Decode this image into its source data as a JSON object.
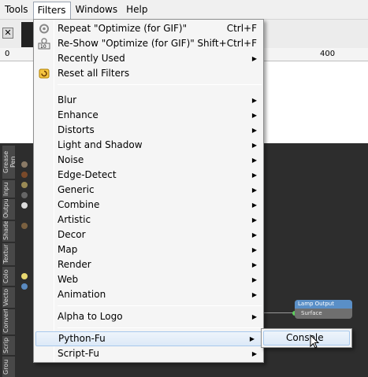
{
  "menubar": {
    "items": [
      {
        "label": "Tools"
      },
      {
        "label": "Filters"
      },
      {
        "label": "Windows"
      },
      {
        "label": "Help"
      }
    ]
  },
  "ruler": {
    "labels": [
      "0",
      "400"
    ]
  },
  "side_tabs": [
    "Grease Pen",
    "Inpu",
    "Outpu",
    "Shade",
    "Textur",
    "Colo",
    "Vecto",
    "Convert",
    "Scrip",
    "Grou"
  ],
  "node": {
    "title": "Lamp Output",
    "socket": "Surface"
  },
  "filters_menu": {
    "repeat": {
      "label": "Repeat \"Optimize (for GIF)\"",
      "shortcut": "Ctrl+F",
      "icon": "repeat-icon"
    },
    "reshow": {
      "label": "Re-Show \"Optimize (for GIF)\"",
      "shortcut": "Shift+Ctrl+F",
      "icon": "reshow-icon"
    },
    "recently_used": {
      "label": "Recently Used"
    },
    "reset_all": {
      "label": "Reset all Filters",
      "icon": "reset-icon"
    },
    "categories": [
      {
        "label": "Blur"
      },
      {
        "label": "Enhance"
      },
      {
        "label": "Distorts"
      },
      {
        "label": "Light and Shadow"
      },
      {
        "label": "Noise"
      },
      {
        "label": "Edge-Detect"
      },
      {
        "label": "Generic"
      },
      {
        "label": "Combine"
      },
      {
        "label": "Artistic"
      },
      {
        "label": "Decor"
      },
      {
        "label": "Map"
      },
      {
        "label": "Render"
      },
      {
        "label": "Web"
      },
      {
        "label": "Animation"
      }
    ],
    "alpha_to_logo": {
      "label": "Alpha to Logo"
    },
    "python_fu": {
      "label": "Python-Fu"
    },
    "script_fu": {
      "label": "Script-Fu"
    }
  },
  "python_submenu": {
    "console": "Console"
  },
  "colors": {
    "highlight": "#dce9f7",
    "menu_bg": "#f5f5f5"
  }
}
